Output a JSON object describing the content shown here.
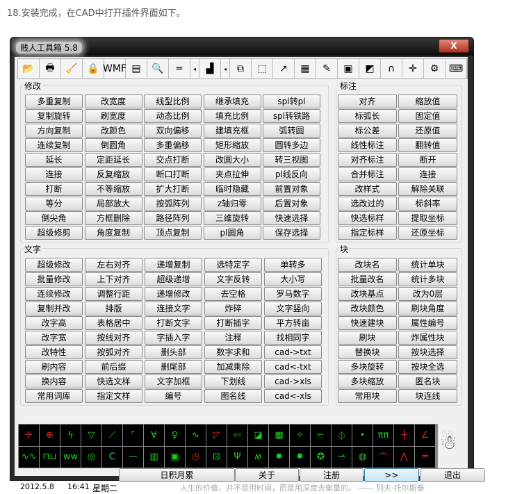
{
  "caption": "18.安装完成，在CAD中打开插件界面如下。",
  "window": {
    "title": "贱人工具箱 5.8",
    "close": "X"
  },
  "toolbar": [
    "📂",
    "🖶",
    "🧹",
    "🔒",
    "WMF",
    "▤",
    "🔍",
    "═",
    "◂",
    "▟",
    "◂",
    "⧉",
    "⬚",
    "↗",
    "▦",
    "✎",
    "▣",
    "◩",
    "∩",
    "✛",
    "⚙",
    "⌨"
  ],
  "groups": {
    "modify": {
      "label": "修改",
      "buttons": [
        "多重复制",
        "改宽度",
        "线型比例",
        "继承填充",
        "spl转pl",
        "复制旋转",
        "刷宽度",
        "动态比例",
        "填充比例",
        "spl转铁路",
        "方向复制",
        "改颜色",
        "双向偏移",
        "建填充框",
        "弧转圆",
        "连续复制",
        "倒圆角",
        "多重偏移",
        "矩形缩放",
        "圆转多边",
        "延长",
        "定距延长",
        "交点打断",
        "改圆大小",
        "转三视图",
        "连接",
        "反复缩放",
        "断口打断",
        "夹点拉伸",
        "pl线反向",
        "打断",
        "不等缩放",
        "扩大打断",
        "临时隐藏",
        "前置对象",
        "等分",
        "局部放大",
        "按弧阵列",
        "z轴归零",
        "后置对象",
        "倒尖角",
        "方框删除",
        "路径阵列",
        "三维旋转",
        "快速选择",
        "超级修剪",
        "角度复制",
        "顶点复制",
        "pl圆角",
        "保存选择"
      ]
    },
    "dim": {
      "label": "标注",
      "buttons": [
        "对齐",
        "缩放值",
        "标弧长",
        "固定值",
        "标公差",
        "还原值",
        "线性标注",
        "翻转值",
        "对齐标注",
        "断开",
        "合并标注",
        "连接",
        "改样式",
        "解除关联",
        "选改过的",
        "标斜率",
        "快选标样",
        "提取坐标",
        "指定标样",
        "还原坐标"
      ]
    },
    "text": {
      "label": "文字",
      "buttons": [
        "超级修改",
        "左右对齐",
        "递增复制",
        "选特定字",
        "单转多",
        "批量修改",
        "上下对齐",
        "超级递增",
        "文字反转",
        "大小写",
        "连续修改",
        "调整行距",
        "递增修改",
        "去空格",
        "罗马数字",
        "复制并改",
        "排版",
        "连接文字",
        "炸碎",
        "文字竖向",
        "改字高",
        "表格居中",
        "打断文字",
        "打断插字",
        "平方转亩",
        "改字宽",
        "按线对齐",
        "字插入字",
        "注释",
        "找相同字",
        "改特性",
        "按弧对齐",
        "删头部",
        "数字求和",
        "cad->txt",
        "刷内容",
        "前后缀",
        "删尾部",
        "加减乘除",
        "cad<-txt",
        "换内容",
        "快选文样",
        "文字加框",
        "下划线",
        "cad->xls",
        "常用词库",
        "指定文样",
        "编号",
        "图名线",
        "cad<-xls"
      ]
    },
    "block": {
      "label": "块",
      "buttons": [
        "改块名",
        "统计单块",
        "批量改名",
        "统计多块",
        "改块基点",
        "改为0层",
        "改块颜色",
        "刷块角度",
        "快速建块",
        "属性编号",
        "刷块",
        "炸属性块",
        "替换块",
        "按块选择",
        "多块旋转",
        "按块全选",
        "多块缩放",
        "匿名块",
        "常用块",
        "块连线"
      ]
    }
  },
  "symbols": [
    "✛",
    "⊕",
    "ϟ",
    "▽",
    "⟋",
    "⌜",
    "∀",
    "♀",
    "∿",
    "◸",
    "⇦",
    "◪",
    "▦",
    "✧",
    "⌐",
    "⏀",
    "•",
    "ππ",
    "┼",
    "∠",
    "∿∿",
    "⊓⊔",
    "ww",
    "◎",
    "ᑕ",
    "—",
    "▥",
    "▣",
    "◷",
    "⊡",
    "Ψ",
    "ʍ",
    "✹",
    "✹",
    "✪",
    "⇀",
    "◍",
    "⌒",
    "⋀",
    "═"
  ],
  "symbol_red": [
    0,
    1,
    9,
    18,
    19,
    28,
    37,
    38,
    39
  ],
  "bottom": {
    "tips": "日积月累",
    "about": "关于",
    "register": "注册",
    "more": ">>",
    "exit": "退出"
  },
  "status": {
    "date": "2012.5.8",
    "time": "16:41",
    "weekday": "星期二",
    "quote": "人生的价值，并不是用时间，而是用深度去衡量的。 —— 列夫·托尔斯泰"
  }
}
